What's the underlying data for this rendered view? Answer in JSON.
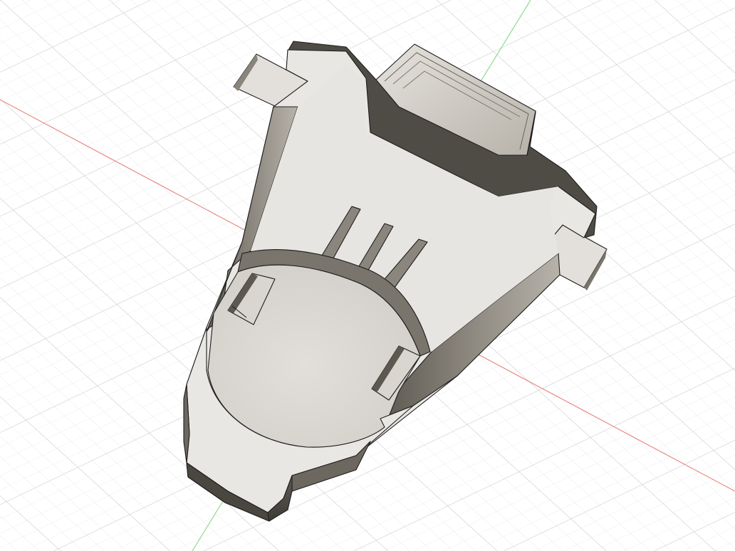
{
  "viewport": {
    "type": "3d-canvas",
    "background": "#ffffff"
  },
  "scene": {
    "grid": {
      "visible": true,
      "minor_color": "#e4e4e4",
      "major_color": "#c9c9c9"
    },
    "axes": {
      "x_axis_color": "#e98a84",
      "y_axis_color": "#8fdc8f"
    },
    "model": {
      "body_color": "#e9e7e3",
      "face_color": "#dedbd5",
      "dark_wall_color": "#6f6a62",
      "mid_wall_color": "#9a958c",
      "edge_color": "#1e1e1e"
    }
  }
}
